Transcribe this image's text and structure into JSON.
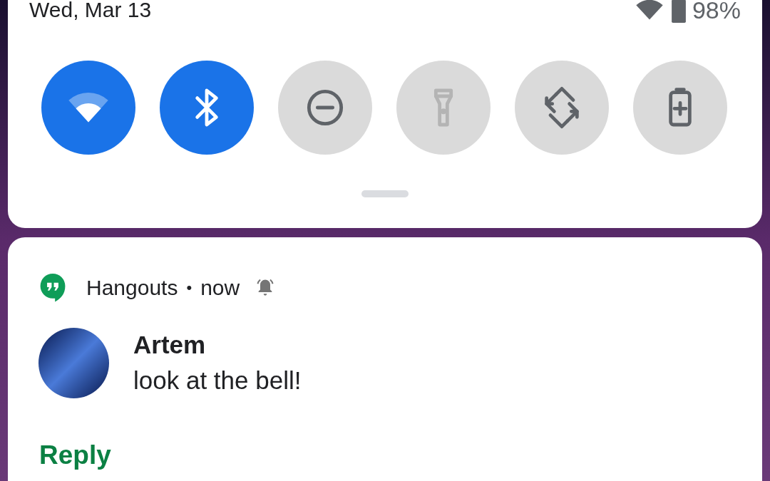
{
  "status": {
    "date": "Wed, Mar 13",
    "battery": "98%"
  },
  "tiles": [
    {
      "kind": "wifi",
      "on": true,
      "disabled": false
    },
    {
      "kind": "bluetooth",
      "on": true,
      "disabled": false
    },
    {
      "kind": "dnd",
      "on": false,
      "disabled": false
    },
    {
      "kind": "flashlight",
      "on": false,
      "disabled": true
    },
    {
      "kind": "rotate",
      "on": false,
      "disabled": false
    },
    {
      "kind": "battery_saver",
      "on": false,
      "disabled": false
    }
  ],
  "notification": {
    "app": "Hangouts",
    "separator": "•",
    "time": "now",
    "alerting": true,
    "sender": "Artem",
    "message": "look at the bell!",
    "action": "Reply"
  }
}
